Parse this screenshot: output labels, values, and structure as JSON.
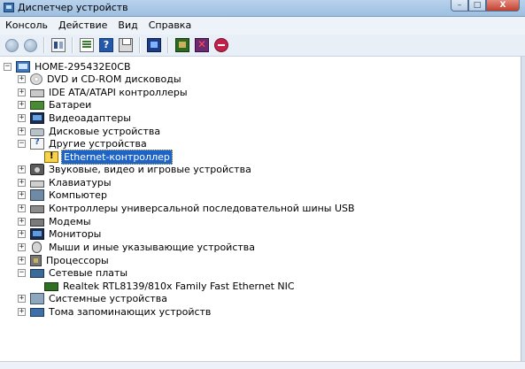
{
  "window": {
    "title": "Диспетчер устройств",
    "controls": {
      "minimize": "–",
      "maximize": "□",
      "close": "X"
    }
  },
  "menu": [
    "Консоль",
    "Действие",
    "Вид",
    "Справка"
  ],
  "toolbar": {
    "buttons": [
      "back-icon",
      "forward-icon",
      "properties-icon",
      "update-driver-icon",
      "help-icon",
      "print-icon",
      "scan-hardware-icon",
      "board-icon",
      "remove-device-icon",
      "disable-device-icon"
    ]
  },
  "tree": {
    "root": "HOME-295432E0CB",
    "items": [
      {
        "label": "DVD и CD-ROM дисководы",
        "expanded": false
      },
      {
        "label": "IDE ATA/ATAPI контроллеры",
        "expanded": false
      },
      {
        "label": "Батареи",
        "expanded": false
      },
      {
        "label": "Видеоадаптеры",
        "expanded": false
      },
      {
        "label": "Дисковые устройства",
        "expanded": false
      },
      {
        "label": "Другие устройства",
        "expanded": true,
        "children": [
          "Ethernet-контроллер"
        ]
      },
      {
        "label": "Звуковые, видео и игровые устройства",
        "expanded": false
      },
      {
        "label": "Клавиатуры",
        "expanded": false
      },
      {
        "label": "Компьютер",
        "expanded": false
      },
      {
        "label": "Контроллеры универсальной последовательной шины USB",
        "expanded": false
      },
      {
        "label": "Модемы",
        "expanded": false
      },
      {
        "label": "Мониторы",
        "expanded": false
      },
      {
        "label": "Мыши и иные указывающие устройства",
        "expanded": false
      },
      {
        "label": "Процессоры",
        "expanded": false
      },
      {
        "label": "Сетевые платы",
        "expanded": true,
        "children": [
          "Realtek RTL8139/810x Family Fast Ethernet NIC"
        ]
      },
      {
        "label": "Системные устройства",
        "expanded": false
      },
      {
        "label": "Тома запоминающих устройств",
        "expanded": false
      }
    ],
    "selected": "Ethernet-контроллер",
    "collapsed_glyph": "+",
    "expanded_glyph": "−",
    "root_glyph": "−"
  }
}
